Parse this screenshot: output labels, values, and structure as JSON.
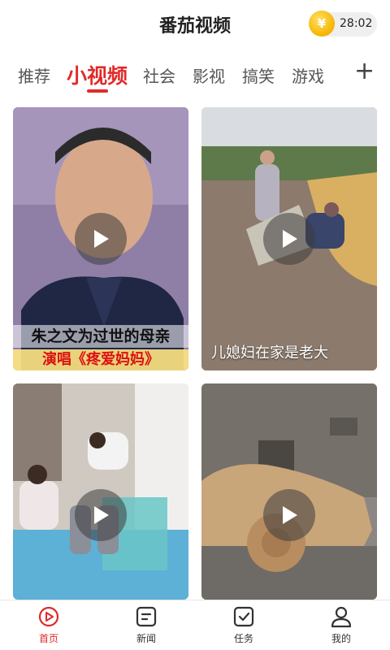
{
  "header": {
    "title": "番茄视频",
    "coin_symbol": "¥",
    "timer": "28:02"
  },
  "tabs": [
    {
      "label": "推荐",
      "active": false
    },
    {
      "label": "小视频",
      "active": true
    },
    {
      "label": "社会",
      "active": false
    },
    {
      "label": "影视",
      "active": false
    },
    {
      "label": "搞笑",
      "active": false
    },
    {
      "label": "游戏",
      "active": false
    }
  ],
  "add_tab_symbol": "+",
  "videos": [
    {
      "overlay_line1": "朱之文为过世的母亲",
      "overlay_line2": "演唱《疼爱妈妈》",
      "caption": ""
    },
    {
      "overlay_line1": "",
      "overlay_line2": "",
      "caption": "儿媳妇在家是老大"
    },
    {
      "overlay_line1": "",
      "overlay_line2": "",
      "caption": ""
    },
    {
      "overlay_line1": "",
      "overlay_line2": "",
      "caption": ""
    }
  ],
  "bottom_nav": [
    {
      "label": "首页",
      "icon": "home-play-icon",
      "active": true
    },
    {
      "label": "新闻",
      "icon": "news-icon",
      "active": false
    },
    {
      "label": "任务",
      "icon": "task-icon",
      "active": false
    },
    {
      "label": "我的",
      "icon": "profile-icon",
      "active": false
    }
  ],
  "colors": {
    "accent": "#e02a2a",
    "coin": "#f5b400"
  }
}
